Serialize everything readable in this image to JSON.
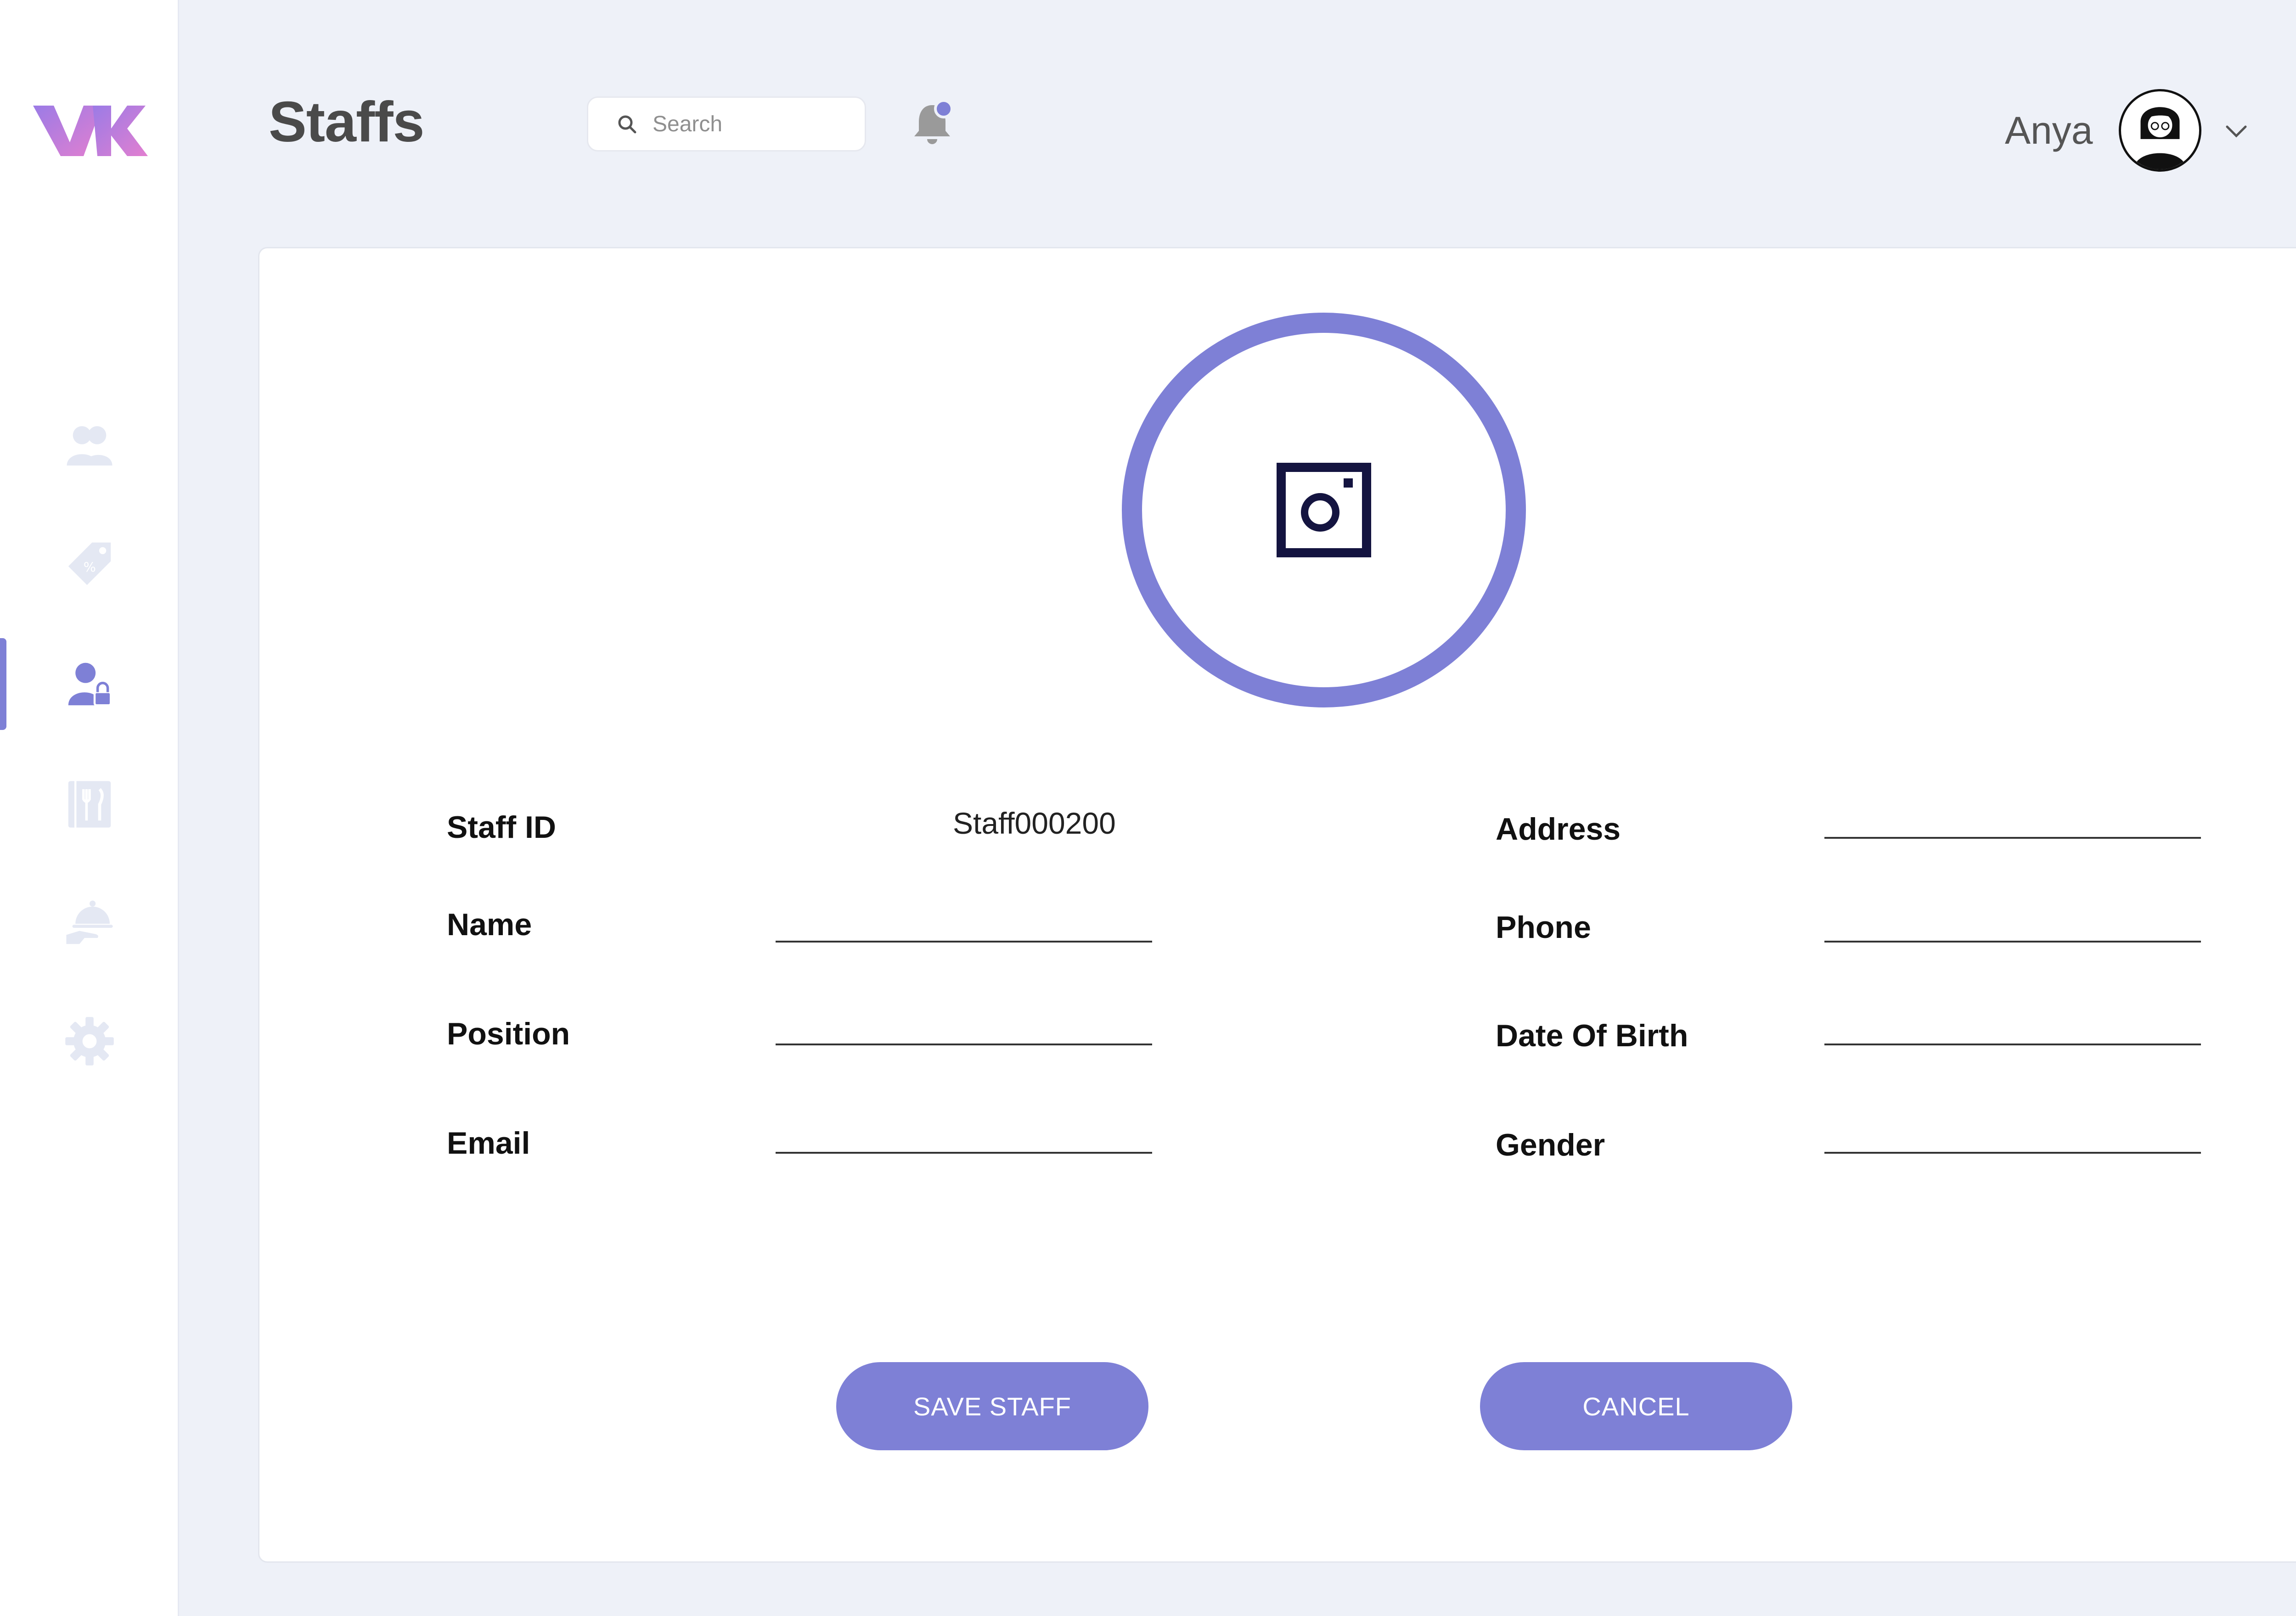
{
  "app": {
    "page_title": "Staffs",
    "accent_color": "#7e80d6",
    "logo": "vk-logo"
  },
  "sidebar": {
    "items": [
      {
        "id": "customers",
        "icon": "users-icon",
        "active": false
      },
      {
        "id": "offers",
        "icon": "price-tag-icon",
        "active": false
      },
      {
        "id": "staffs",
        "icon": "staff-lock-icon",
        "active": true
      },
      {
        "id": "menu",
        "icon": "menu-utensils-icon",
        "active": false
      },
      {
        "id": "orders",
        "icon": "serving-cloche-icon",
        "active": false
      },
      {
        "id": "settings",
        "icon": "gear-icon",
        "active": false
      }
    ]
  },
  "header": {
    "search_placeholder": "Search",
    "notification_badge_color": "#7e80d6",
    "user": {
      "name": "Anya"
    }
  },
  "form": {
    "photo_icon": "camera-icon",
    "left_fields": [
      {
        "label": "Staff ID",
        "value": "Staff000200"
      },
      {
        "label": "Name",
        "value": ""
      },
      {
        "label": "Position",
        "value": ""
      },
      {
        "label": "Email",
        "value": ""
      }
    ],
    "right_fields": [
      {
        "label": "Address",
        "value": ""
      },
      {
        "label": "Phone",
        "value": ""
      },
      {
        "label": "Date Of Birth",
        "value": ""
      },
      {
        "label": "Gender",
        "value": ""
      }
    ],
    "save_label": "SAVE STAFF",
    "cancel_label": "CANCEL"
  }
}
